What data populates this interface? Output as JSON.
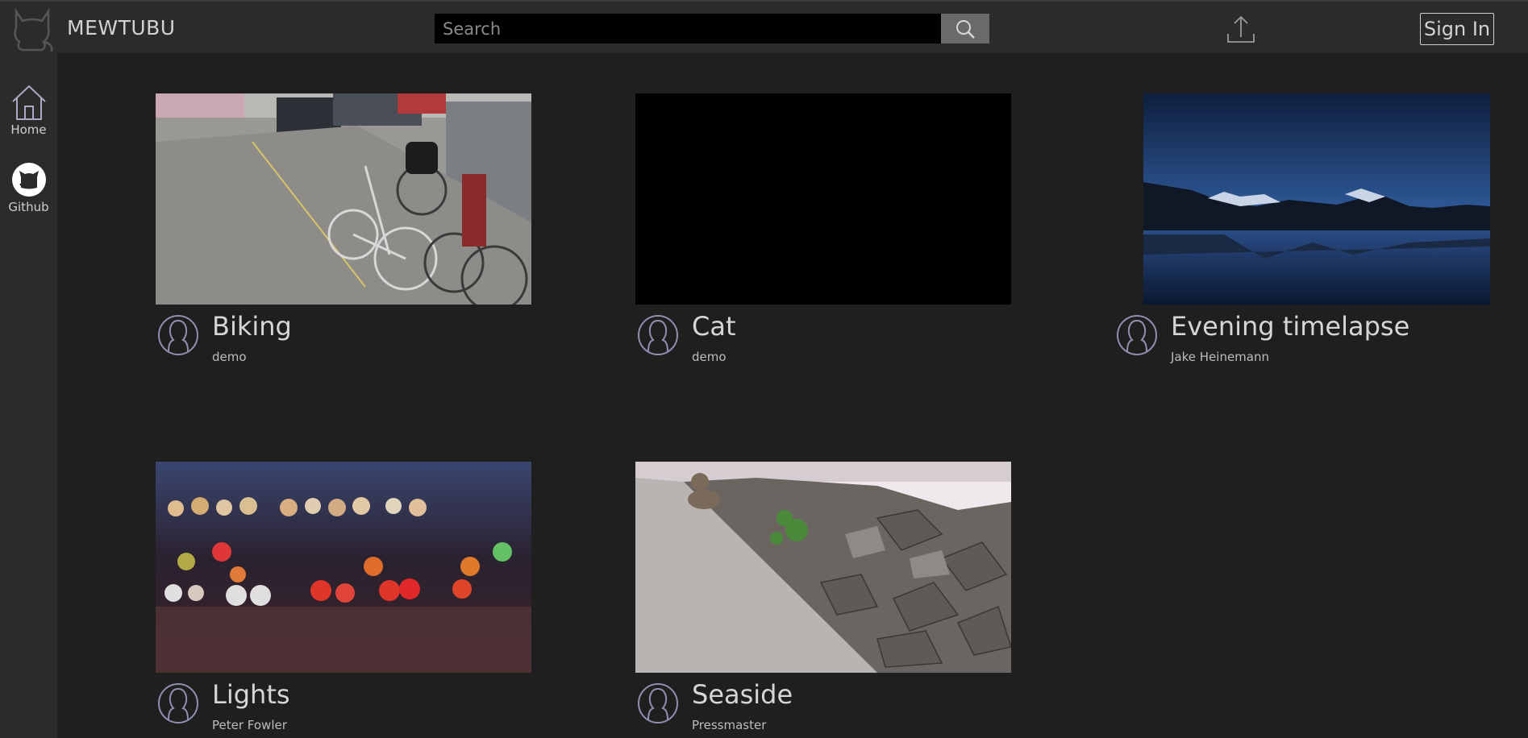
{
  "app": {
    "brand": "MEWTUBU"
  },
  "search": {
    "placeholder": "Search",
    "value": ""
  },
  "header": {
    "signin_label": "Sign In"
  },
  "sidebar": {
    "items": [
      {
        "label": "Home",
        "icon": "home-icon"
      },
      {
        "label": "Github",
        "icon": "github-icon"
      }
    ]
  },
  "videos": [
    {
      "title": "Biking",
      "author": "demo",
      "thumbnail": "bikes-parked-street"
    },
    {
      "title": "Cat",
      "author": "demo",
      "thumbnail": "black-frame"
    },
    {
      "title": "Evening timelapse",
      "author": "Jake Heinemann",
      "thumbnail": "mountain-lake-night"
    },
    {
      "title": "Lights",
      "author": "Peter Fowler",
      "thumbnail": "bokeh-city-lights"
    },
    {
      "title": "Seaside",
      "author": "Pressmaster",
      "thumbnail": "cat-on-seawall-rocks"
    }
  ],
  "colors": {
    "background": "#1f1f1f",
    "bar": "#2b2b2b",
    "text": "#cfcfcf"
  }
}
